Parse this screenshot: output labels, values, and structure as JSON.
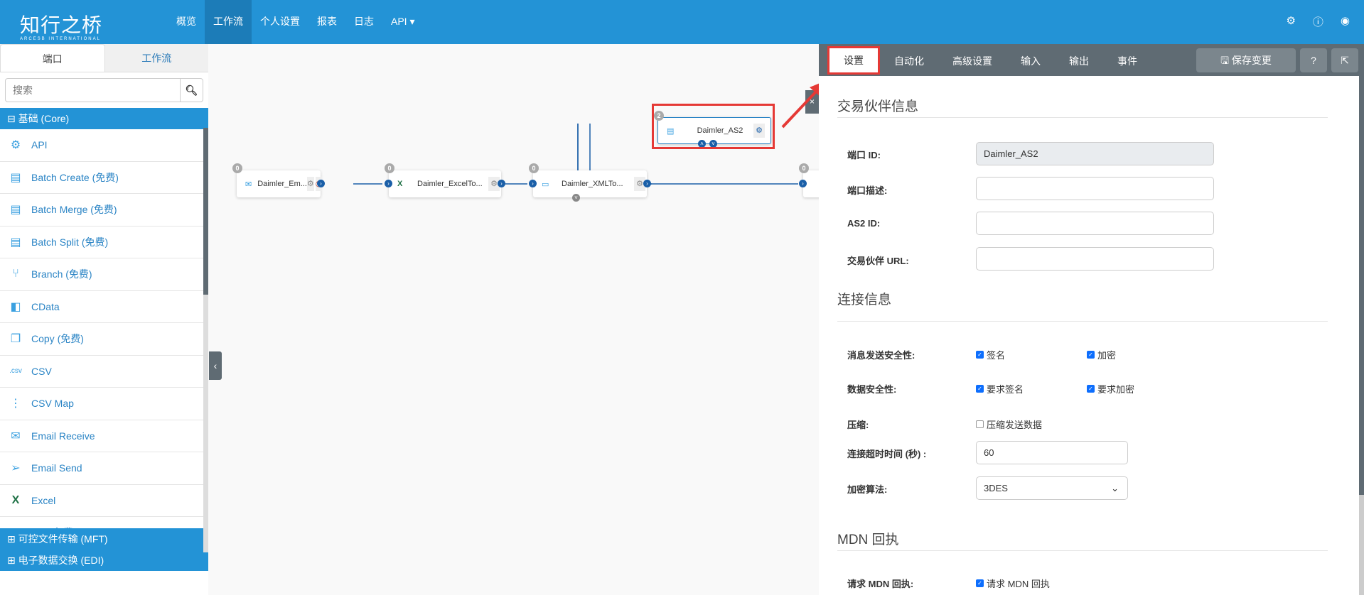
{
  "header": {
    "logo": "知行之桥",
    "logo_sub": "ARCESB INTERNATIONAL",
    "nav": [
      "概览",
      "工作流",
      "个人设置",
      "报表",
      "日志",
      "API ▾"
    ],
    "active_nav": 1,
    "icons": [
      "gear-icon",
      "help-icon",
      "user-icon"
    ]
  },
  "sidebar": {
    "tabs": [
      "端口",
      "工作流"
    ],
    "search_placeholder": "搜索",
    "core_group": "⊟ 基础 (Core)",
    "items": [
      {
        "label": "API",
        "icon": "⚙"
      },
      {
        "label": "Batch Create (免费)",
        "icon": "▤"
      },
      {
        "label": "Batch Merge (免费)",
        "icon": "▤"
      },
      {
        "label": "Batch Split (免费)",
        "icon": "▤"
      },
      {
        "label": "Branch (免费)",
        "icon": "⑂"
      },
      {
        "label": "CData",
        "icon": "◧"
      },
      {
        "label": "Copy (免费)",
        "icon": "❐"
      },
      {
        "label": "CSV",
        "icon": ".csv"
      },
      {
        "label": "CSV Map",
        "icon": "⋮"
      },
      {
        "label": "Email Receive",
        "icon": "✉"
      },
      {
        "label": "Email Send",
        "icon": "➢"
      },
      {
        "label": "Excel",
        "icon": "X"
      },
      {
        "label": "File (免费)",
        "icon": "▭"
      }
    ],
    "groups": [
      "⊞ 可控文件传输 (MFT)",
      "⊞ 电子数据交换 (EDI)"
    ]
  },
  "canvas": {
    "nodes": [
      {
        "label": "Daimler_Em...",
        "badge": "0"
      },
      {
        "label": "Daimler_ExcelTo...",
        "badge": "0"
      },
      {
        "label": "Daimler_XMLTo...",
        "badge": "0"
      },
      {
        "label": "Daimler_AS2",
        "badge": "2"
      },
      {
        "label": "",
        "badge": "0"
      }
    ],
    "close": "×"
  },
  "panel": {
    "tabs": [
      "设置",
      "自动化",
      "高级设置",
      "输入",
      "输出",
      "事件"
    ],
    "save": "🖫 保存变更",
    "help": "?",
    "popout": "⇱",
    "sec1": "交易伙伴信息",
    "port_id_label": "端口 ID:",
    "port_id": "Daimler_AS2",
    "desc_label": "端口描述:",
    "as2_label": "AS2 ID:",
    "url_label": "交易伙伴 URL:",
    "sec2": "连接信息",
    "msg_sec_label": "消息发送安全性:",
    "sign": "签名",
    "encrypt": "加密",
    "data_sec_label": "数据安全性:",
    "req_sign": "要求签名",
    "req_encrypt": "要求加密",
    "compress_label": "压缩:",
    "compress": "压缩发送数据",
    "timeout_label": "连接超时时间 (秒) :",
    "timeout": "60",
    "algo_label": "加密算法:",
    "algo": "3DES",
    "sec3": "MDN 回执",
    "mdn_label": "请求 MDN 回执:",
    "mdn": "请求 MDN 回执"
  },
  "colors": {
    "brand": "#2393d6",
    "panel_bar": "#5f6b73",
    "highlight": "#e53935"
  }
}
